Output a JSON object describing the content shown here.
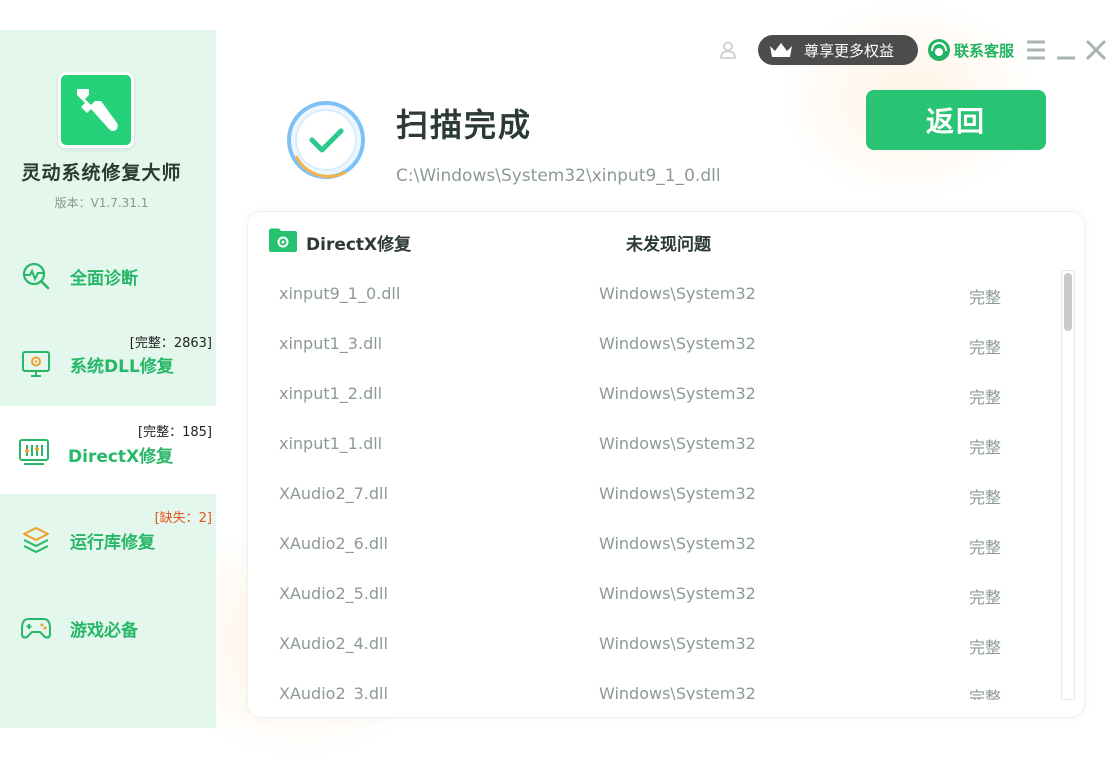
{
  "colors": {
    "brand": "#25d279",
    "sidebar_bg": "#e4f7ec",
    "accent_text": "#27b768",
    "warn": "#e8541f",
    "muted": "#8d9a94"
  },
  "app": {
    "name": "灵动系统修复大师",
    "version": "版本：V1.7.31.1"
  },
  "sidebar": {
    "items": [
      {
        "label": "全面诊断",
        "badge": "",
        "icon": "diagnosis-icon"
      },
      {
        "label": "系统DLL修复",
        "badge": "[完整：2863]",
        "icon": "dll-repair-icon"
      },
      {
        "label": "DirectX修复",
        "badge": "[完整：185]",
        "icon": "directx-icon",
        "active": true
      },
      {
        "label": "运行库修复",
        "badge": "[缺失：2]",
        "icon": "runtime-icon",
        "warn": true
      },
      {
        "label": "游戏必备",
        "badge": "",
        "icon": "gamepad-icon"
      }
    ]
  },
  "header": {
    "vip_label": "尊享更多权益",
    "service_label": "联系客服"
  },
  "scan": {
    "title": "扫描完成",
    "path": "C:\\Windows\\System32\\xinput9_1_0.dll",
    "back_label": "返回"
  },
  "result": {
    "title": "DirectX修复",
    "status": "未发现问题",
    "rows": [
      {
        "file": "xinput9_1_0.dll",
        "dir": "Windows\\System32",
        "status": "完整"
      },
      {
        "file": "xinput1_3.dll",
        "dir": "Windows\\System32",
        "status": "完整"
      },
      {
        "file": "xinput1_2.dll",
        "dir": "Windows\\System32",
        "status": "完整"
      },
      {
        "file": "xinput1_1.dll",
        "dir": "Windows\\System32",
        "status": "完整"
      },
      {
        "file": "XAudio2_7.dll",
        "dir": "Windows\\System32",
        "status": "完整"
      },
      {
        "file": "XAudio2_6.dll",
        "dir": "Windows\\System32",
        "status": "完整"
      },
      {
        "file": "XAudio2_5.dll",
        "dir": "Windows\\System32",
        "status": "完整"
      },
      {
        "file": "XAudio2_4.dll",
        "dir": "Windows\\System32",
        "status": "完整"
      },
      {
        "file": "XAudio2_3.dll",
        "dir": "Windows\\System32",
        "status": "完整"
      }
    ]
  }
}
